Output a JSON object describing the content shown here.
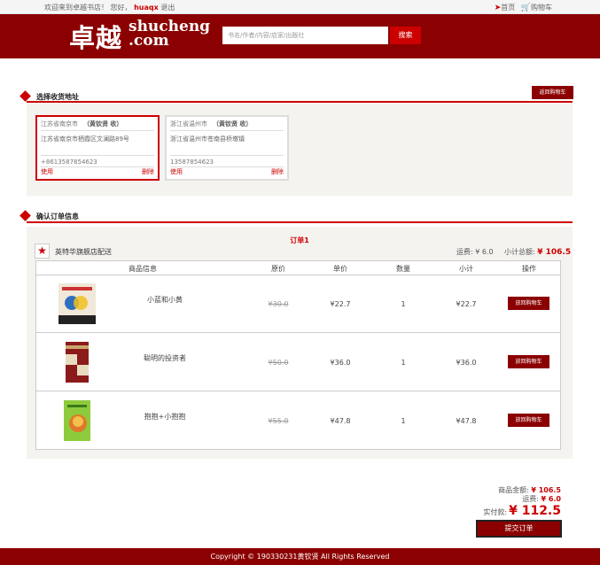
{
  "topbar": {
    "welcome": "欢迎来到卓越书店！",
    "greeting": "您好，",
    "username": "huaqx",
    "logout": "退出",
    "home": "首页",
    "cart": "购物车",
    "home_icon": "send-icon",
    "cart_icon": "cart-icon"
  },
  "header": {
    "logo_cn": "卓越",
    "logo_en_line1": "shucheng",
    "logo_en_line2": ".com",
    "search_placeholder": "书名/作者/内容/店家/出版社",
    "search_button": "搜索"
  },
  "address_section": {
    "title": "选择收货地址",
    "back_to_cart": "返回购物车",
    "cards": [
      {
        "region": "江苏省南京市",
        "recipient": "（黄钦贤 收）",
        "street": "江苏省南京市栖霞区文澜路89号",
        "phone": "+8613587854623",
        "use": "使用",
        "delete": "删除",
        "selected": true
      },
      {
        "region": "浙江省温州市",
        "recipient": "（黄钦贤 收）",
        "street": "浙江省温州市苍南县桥墩镇",
        "phone": "13587854623",
        "use": "使用",
        "delete": "删除",
        "selected": false
      }
    ]
  },
  "order_section": {
    "title": "确认订单信息",
    "order_no": "订单1",
    "shop_name": "英特华旗舰店配送",
    "shipping_label": "运费: ¥ 6.0",
    "subtotal_label": "小计总额:",
    "subtotal_value": "¥ 106.5",
    "columns": [
      "商品信息",
      "原价",
      "单价",
      "数量",
      "小计",
      "操作"
    ],
    "items": [
      {
        "name": "小蓝和小黄",
        "orig": "¥30.0",
        "price": "¥22.7",
        "qty": "1",
        "subtotal": "¥22.7",
        "action": "放回购物车"
      },
      {
        "name": "聪明的投资者",
        "orig": "¥50.0",
        "price": "¥36.0",
        "qty": "1",
        "subtotal": "¥36.0",
        "action": "放回购物车"
      },
      {
        "name": "抱抱+小抱抱",
        "orig": "¥55.0",
        "price": "¥47.8",
        "qty": "1",
        "subtotal": "¥47.8",
        "action": "放回购物车"
      }
    ]
  },
  "summary": {
    "goods_label": "商品金额:",
    "goods_value": "¥ 106.5",
    "shipping_label": "运费:",
    "shipping_value": "¥ 6.0",
    "pay_label": "实付款:",
    "pay_value": "¥ 112.5",
    "submit": "提交订单"
  },
  "footer": {
    "copyright": "Copyright © 190330231黄钦贤 All Rights Reserved"
  },
  "colors": {
    "brand": "#8b0000",
    "accent": "#cc0000"
  }
}
